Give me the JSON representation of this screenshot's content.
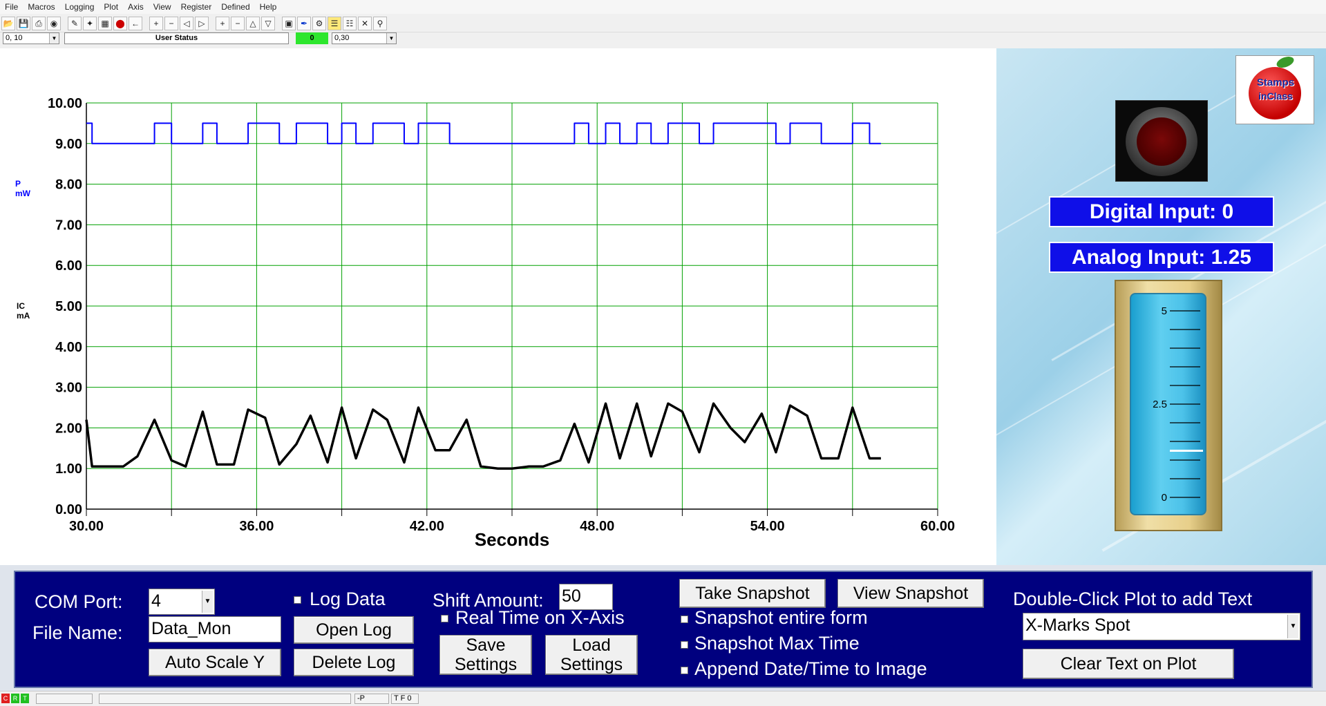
{
  "menu": [
    "File",
    "Macros",
    "Logging",
    "Plot",
    "Axis",
    "View",
    "Register",
    "Defined",
    "Help"
  ],
  "toolbar_row": {
    "combo_left": "0, 10",
    "user_status": "User Status",
    "green_value": "0",
    "combo_right": "0,30"
  },
  "plot": {
    "ylabels": [
      "10.00",
      "9.00",
      "8.00",
      "7.00",
      "6.00",
      "5.00",
      "4.00",
      "3.00",
      "2.00",
      "1.00",
      "0.00"
    ],
    "xlabels": [
      "30.00",
      "36.00",
      "42.00",
      "48.00",
      "54.00",
      "60.00"
    ],
    "xlabel": "Seconds",
    "series_labels": [
      {
        "name": "P",
        "unit": "mW",
        "color": "#0000ff"
      },
      {
        "name": "IC",
        "unit": "mA",
        "color": "#000000"
      }
    ]
  },
  "chart_data": {
    "type": "line",
    "xlabel": "Seconds",
    "ylabel": "",
    "xlim": [
      30,
      60
    ],
    "ylim": [
      0,
      10
    ],
    "grid": true,
    "series": [
      {
        "name": "P",
        "unit": "mW",
        "color": "#0000ff",
        "step": true,
        "x": [
          30.0,
          30.2,
          32.4,
          33.0,
          34.1,
          34.6,
          35.7,
          36.8,
          37.4,
          38.5,
          39.0,
          39.5,
          40.1,
          41.2,
          41.7,
          42.8,
          44.0,
          47.2,
          47.7,
          48.3,
          48.8,
          49.4,
          49.9,
          50.5,
          51.6,
          52.1,
          54.3,
          54.8,
          55.9,
          57.0,
          57.6,
          58.0
        ],
        "values": [
          9.5,
          9.0,
          9.5,
          9.0,
          9.5,
          9.0,
          9.5,
          9.0,
          9.5,
          9.0,
          9.5,
          9.0,
          9.5,
          9.0,
          9.5,
          9.0,
          9.0,
          9.5,
          9.0,
          9.5,
          9.0,
          9.5,
          9.0,
          9.5,
          9.0,
          9.5,
          9.0,
          9.5,
          9.0,
          9.5,
          9.0,
          9.0
        ]
      },
      {
        "name": "IC",
        "unit": "mA",
        "color": "#000000",
        "step": false,
        "x": [
          30.0,
          30.2,
          31.3,
          31.8,
          32.4,
          33.0,
          33.5,
          34.1,
          34.6,
          35.2,
          35.7,
          36.3,
          36.8,
          37.4,
          37.9,
          38.5,
          39.0,
          39.5,
          40.1,
          40.6,
          41.2,
          41.7,
          42.3,
          42.8,
          43.4,
          43.9,
          44.5,
          45.0,
          45.6,
          46.1,
          46.7,
          47.2,
          47.7,
          48.3,
          48.8,
          49.4,
          49.9,
          50.5,
          51.0,
          51.6,
          52.1,
          52.7,
          53.2,
          53.8,
          54.3,
          54.8,
          55.4,
          55.9,
          56.5,
          57.0,
          57.6,
          58.0
        ],
        "values": [
          2.2,
          1.05,
          1.05,
          1.3,
          2.2,
          1.2,
          1.05,
          2.4,
          1.1,
          1.1,
          2.45,
          2.25,
          1.1,
          1.6,
          2.3,
          1.15,
          2.5,
          1.25,
          2.45,
          2.2,
          1.15,
          2.5,
          1.45,
          1.45,
          2.2,
          1.05,
          1.0,
          1.0,
          1.05,
          1.05,
          1.2,
          2.1,
          1.15,
          2.6,
          1.25,
          2.6,
          1.3,
          2.6,
          2.4,
          1.4,
          2.6,
          2.0,
          1.65,
          2.35,
          1.4,
          2.55,
          2.3,
          1.25,
          1.25,
          2.5,
          1.25,
          1.25
        ]
      }
    ]
  },
  "right_panel": {
    "logo_text_top": "Stamps",
    "logo_text_bottom": "inClass",
    "digital_input": "Digital Input: 0",
    "analog_input": "Analog Input: 1.25",
    "gauge": {
      "max_label": "5",
      "mid_label": "2.5",
      "min_label": "0",
      "value": 1.25,
      "min": 0,
      "max": 5
    }
  },
  "controls": {
    "com_port_label": "COM Port:",
    "com_port_value": "4",
    "file_name_label": "File Name:",
    "file_name_value": "Data_Mon",
    "auto_scale_label": "Auto Scale Y",
    "log_data_label": "Log Data",
    "open_log_label": "Open Log",
    "delete_log_label": "Delete Log",
    "shift_amount_label": "Shift Amount:",
    "shift_amount_value": "50",
    "real_time_label": "Real Time on X-Axis",
    "save_settings_label": "Save Settings",
    "load_settings_label": "Load Settings",
    "take_snapshot_label": "Take Snapshot",
    "view_snapshot_label": "View Snapshot",
    "snapshot_entire_label": "Snapshot entire form",
    "snapshot_max_label": "Snapshot Max Time",
    "append_date_label": "Append Date/Time to Image",
    "double_click_label": "Double-Click Plot to add Text",
    "text_select_value": "X-Marks Spot",
    "clear_text_label": "Clear Text on Plot"
  },
  "statusbar": {
    "led_labels": [
      "C",
      "R",
      "T"
    ],
    "box_p": "-P",
    "box_tf": "T F 0"
  }
}
